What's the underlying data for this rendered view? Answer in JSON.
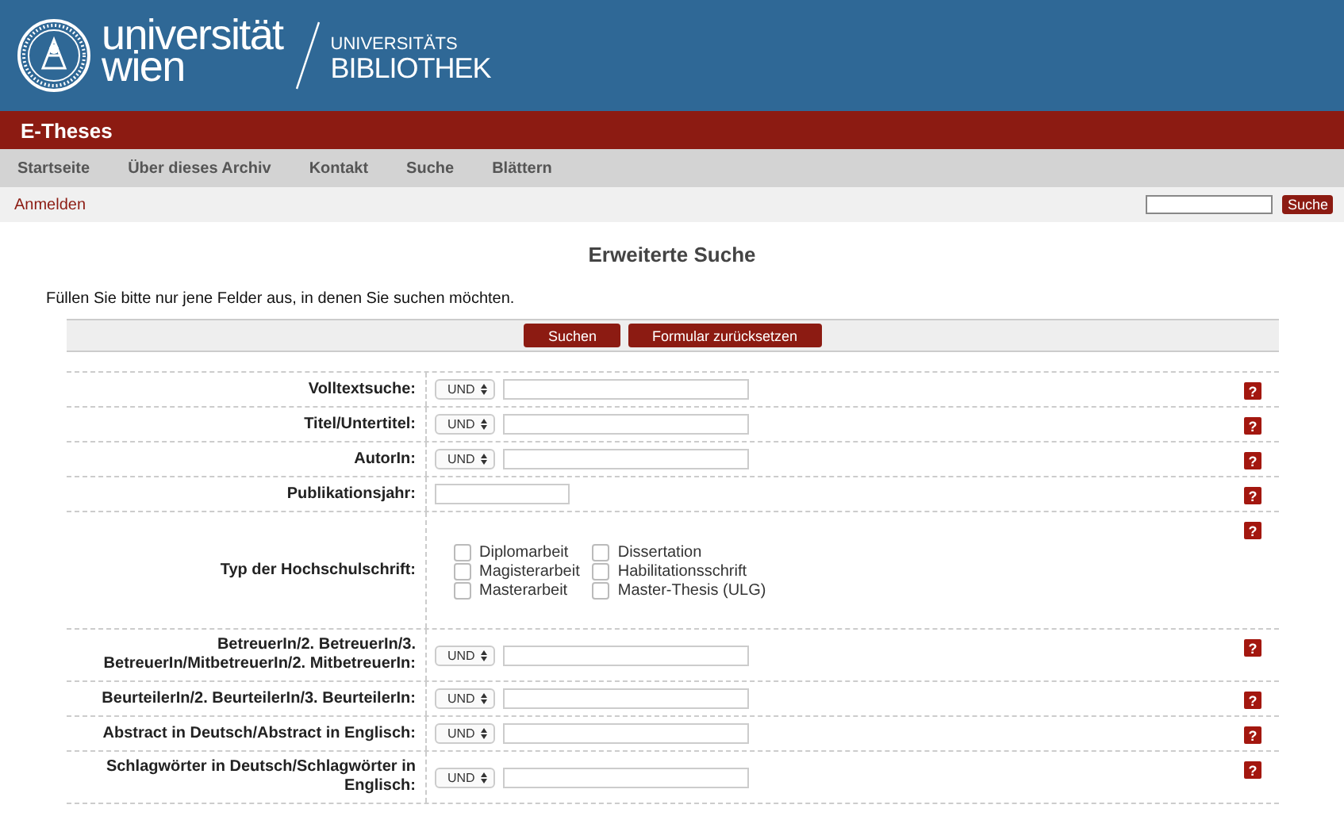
{
  "header": {
    "logo_line1": "universität",
    "logo_line2": "wien",
    "library_line1": "UNIVERSITÄTS",
    "library_line2": "BIBLIOTHEK"
  },
  "site_title": "E-Theses",
  "nav": [
    {
      "label": "Startseite"
    },
    {
      "label": "Über dieses Archiv"
    },
    {
      "label": "Kontakt"
    },
    {
      "label": "Suche"
    },
    {
      "label": "Blättern"
    }
  ],
  "login_link": "Anmelden",
  "quick_search": {
    "button": "Suche"
  },
  "page_title": "Erweiterte Suche",
  "instructions": "Füllen Sie bitte nur jene Felder aus, in denen Sie suchen möchten.",
  "buttons": [
    "Suchen",
    "Formular zurücksetzen"
  ],
  "fields": [
    {
      "kind": "match",
      "label": "Volltextsuche:",
      "operator": "UND",
      "help": "?"
    },
    {
      "kind": "match",
      "label": "Titel/Untertitel:",
      "operator": "UND",
      "help": "?"
    },
    {
      "kind": "match",
      "label": "AutorIn:",
      "operator": "UND",
      "help": "?"
    },
    {
      "kind": "short",
      "label": "Publikationsjahr:",
      "help": "?"
    },
    {
      "kind": "checkboxes",
      "label": "Typ der Hochschulschrift:",
      "help": "?",
      "options": [
        {
          "label": "Diplomarbeit",
          "checked": false
        },
        {
          "label": "Magisterarbeit",
          "checked": false
        },
        {
          "label": "Masterarbeit",
          "checked": false
        },
        {
          "label": "Dissertation",
          "checked": false
        },
        {
          "label": "Habilitationsschrift",
          "checked": false
        },
        {
          "label": "Master-Thesis (ULG)",
          "checked": false
        }
      ]
    },
    {
      "kind": "match",
      "label": "BetreuerIn/2. BetreuerIn/3. BetreuerIn/MitbetreuerIn/2. MitbetreuerIn:",
      "operator": "UND",
      "help": "?"
    },
    {
      "kind": "match",
      "label": "BeurteilerIn/2. BeurteilerIn/3. BeurteilerIn:",
      "operator": "UND",
      "help": "?"
    },
    {
      "kind": "match",
      "label": "Abstract in Deutsch/Abstract in Englisch:",
      "operator": "UND",
      "help": "?"
    },
    {
      "kind": "match",
      "label": "Schlagwörter in Deutsch/Schlagwörter in Englisch:",
      "operator": "UND",
      "help": "?"
    }
  ]
}
